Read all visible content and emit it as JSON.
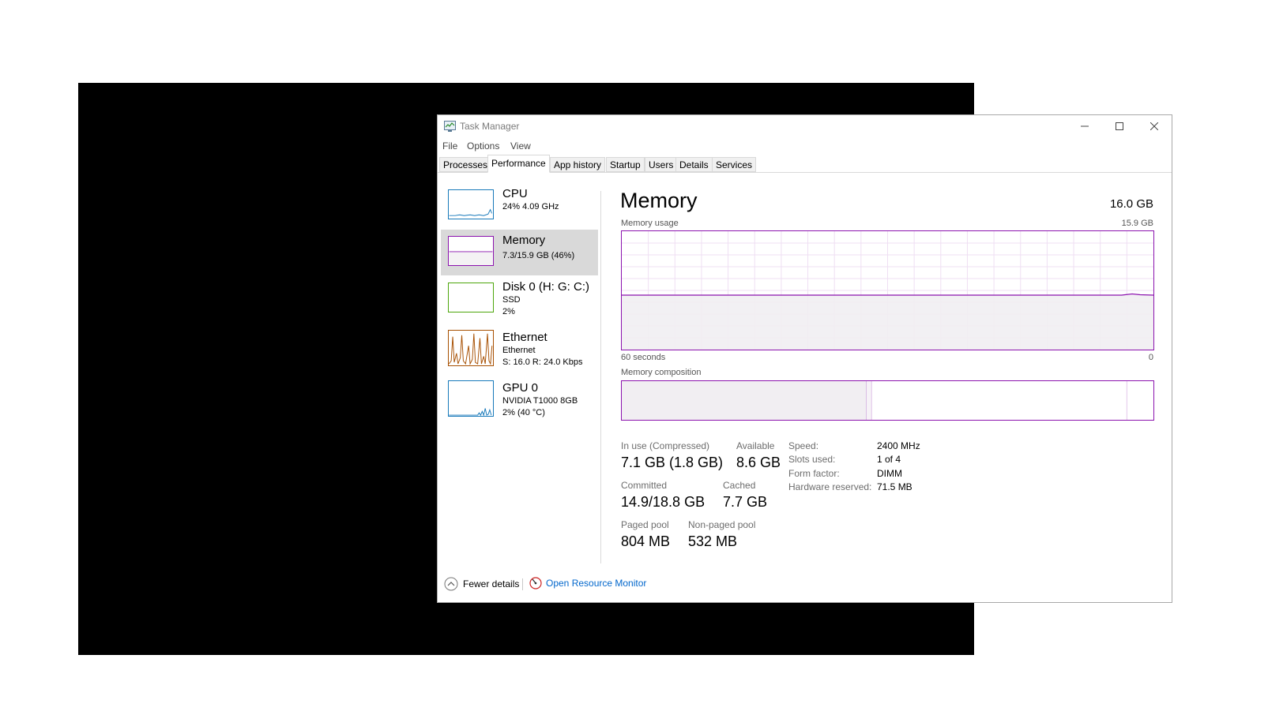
{
  "window": {
    "title": "Task Manager"
  },
  "menu": [
    "File",
    "Options",
    "View"
  ],
  "tabs": [
    "Processes",
    "Performance",
    "App history",
    "Startup",
    "Users",
    "Details",
    "Services"
  ],
  "sidebar": [
    {
      "name": "CPU",
      "line1": "24%  4.09 GHz",
      "line2": "",
      "color": "#1779ba"
    },
    {
      "name": "Memory",
      "line1": "7.3/15.9 GB (46%)",
      "line2": "",
      "color": "#8b12ae"
    },
    {
      "name": "Disk 0 (H: G: C:)",
      "line1": "SSD",
      "line2": "2%",
      "color": "#4da60c"
    },
    {
      "name": "Ethernet",
      "line1": "Ethernet",
      "line2": "S: 16.0  R: 24.0 Kbps",
      "color": "#a74f01"
    },
    {
      "name": "GPU 0",
      "line1": "NVIDIA T1000 8GB",
      "line2": "2%  (40 °C)",
      "color": "#1779ba"
    }
  ],
  "main": {
    "title": "Memory",
    "total": "16.0 GB",
    "usage_label": "Memory usage",
    "usage_max": "15.9 GB",
    "time_label": "60 seconds",
    "time_end": "0",
    "composition_label": "Memory composition",
    "usage_fraction": 0.46,
    "composition": {
      "in_use_fraction": 0.46,
      "modified_fraction": 0.01,
      "standby_fraction": 0.48,
      "free_fraction": 0.05
    }
  },
  "stats": {
    "in_use_label": "In use (Compressed)",
    "in_use_value": "7.1 GB (1.8 GB)",
    "available_label": "Available",
    "available_value": "8.6 GB",
    "committed_label": "Committed",
    "committed_value": "14.9/18.8 GB",
    "cached_label": "Cached",
    "cached_value": "7.7 GB",
    "paged_label": "Paged pool",
    "paged_value": "804 MB",
    "nonpaged_label": "Non-paged pool",
    "nonpaged_value": "532 MB"
  },
  "specs": [
    {
      "label": "Speed:",
      "value": "2400 MHz"
    },
    {
      "label": "Slots used:",
      "value": "1 of 4"
    },
    {
      "label": "Form factor:",
      "value": "DIMM"
    },
    {
      "label": "Hardware reserved:",
      "value": "71.5 MB"
    }
  ],
  "footer": {
    "fewer": "Fewer details",
    "resmon": "Open Resource Monitor"
  },
  "colors": {
    "memory": "#8b12ae",
    "link": "#0066cc"
  }
}
